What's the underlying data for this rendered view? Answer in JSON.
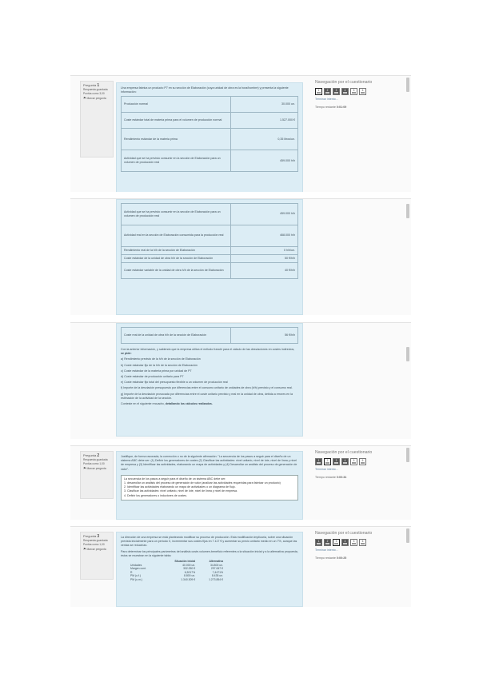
{
  "shot1": {
    "question": {
      "label": "Pregunta",
      "number": "1",
      "status": "Respuesta guardada",
      "score": "Puntúa como 3,00",
      "flag": "Marcar pregunta"
    },
    "intro": "Una empresa fabrica un producto P7 en su sección de Elaboración (cuya unidad de obra es la hora/hombre) y presenta la siguiente información:",
    "table": [
      {
        "label": "Producción normal",
        "value": "30.000 un."
      },
      {
        "label": "Coste estándar total de materia prima para el volumen de producción normal",
        "value": "1.527.000 €"
      },
      {
        "label": "Rendimiento estándar de la materia prima",
        "value": "0,35 litros/un."
      },
      {
        "label": "Actividad que se ha previsto consumir en la sección de Elaboración para un volumen de producción real",
        "value": "459.000 h/h"
      }
    ],
    "nav": {
      "title": "Navegación por el cuestionario",
      "boxes": [
        "1",
        "2",
        "3",
        "4",
        "5",
        "6"
      ],
      "finish": "Terminar intento...",
      "time_label": "Tiempo restante",
      "time_value": "0:01:09"
    }
  },
  "shot2": {
    "table": [
      {
        "label": "Actividad que se ha previsto consumir en la sección de Elaboración para un volumen de producción real",
        "value": "459.000 h/h"
      },
      {
        "label": "Actividad real en la sección de Elaboración consumida para la producción real",
        "value": "468.000 h/h"
      },
      {
        "label": "Rendimiento real de la h/h de la sección de Elaboración",
        "value": "0 h/h/un."
      },
      {
        "label": "Coste estándar de la unidad de obra h/h de la sección de Elaboración",
        "value": "50 €/h/h"
      },
      {
        "label": "Coste estándar variable de la unidad de obra h/h de la sección de Elaboración",
        "value": "40 €/h/h"
      }
    ]
  },
  "shot3": {
    "table": [
      {
        "label": "Coste real de la unidad de obra h/h de la sección de Elaboración",
        "value": "56 €/h/h"
      }
    ],
    "paragraph": "Con la anterior información, y sabiendo que la empresa utiliza el método franchi para el cálculo de las desviaciones en costes indirectos,",
    "ask": "se pide:",
    "items": [
      "a) Rendimiento previsto de la h/h de la sección de Elaboración",
      "b) Coste estándar fijo de la h/h de la sección de Elaboración",
      "c) Coste estándar de la materia prima por unidad de P7",
      "d) Coste estándar de producción unitario para P7",
      "e) Coste estándar fijo total del presupuesto flexible a un volumen de producción real",
      "f) Importe de la desviación presupuesto por diferencias entre el consumo unitario de unidades de obra (h/h) previsto y el consumo real.",
      "g) Importe de la desviación provocada por diferencias entre el coste unitario previsto y real en la unidad de obra, debida a errores en la estimación de la actividad de la sección."
    ],
    "closing": "Conteste en el siguiente recuadro,",
    "closing_bold": "detallando los cálculos realizados."
  },
  "shot4": {
    "question": {
      "label": "Pregunta",
      "number": "2",
      "status": "Respuesta guardada",
      "score": "Puntúa como 1,00",
      "flag": "Marcar pregunta"
    },
    "text": "Justifique, de forma razonada, la corrección o no de la siguiente afirmación: \"La secuencia de los pasos a seguir para el diseño de un sistema ABC debe ser: (1) Definir los generadores de costes (2) Clasificar las actividades: nivel unitario, nivel de lote, nivel de línea y nivel de empresa y (3) Identificar las actividades, elaborando un mapa de actividades y (4) Desarrollar un análisis del proceso de generación de valor\".",
    "answer": [
      "La secuencia de los pasos a seguir para el diseño de un sistema ABC debe ser:",
      "1. desarrollar un análisis del proceso de generación de valor (analizar las actividades requeridas para fabricar un producto)",
      "2. Identificar las actividades elaborando un mapa de actividades o un diagrama de flujo.",
      "3. Clasificar las actividades: nivel unitario, nivel de lote, nivel de línea y nivel de empresa.",
      "4. Definir los generadores o inductores de costes."
    ],
    "nav": {
      "title": "Navegación por el cuestionario",
      "boxes": [
        "1",
        "2",
        "3",
        "4",
        "5",
        "6"
      ],
      "finish": "Terminar intento...",
      "time_label": "Tiempo restante",
      "time_value": "0:00:34"
    }
  },
  "shot5": {
    "question": {
      "label": "Pregunta",
      "number": "3",
      "status": "Respuesta guardada",
      "score": "Puntúa como 1,00",
      "flag": "Marcar pregunta"
    },
    "text1": "La dirección de una empresa se está planteando modificar su proceso de producción. Esta modificación implicaría, sobre una situación prevista inicialmente para un período X, incrementar sus costes fijos en 7.117 € y aumentar su precio unitario medio en un 7%, aunque las ventas se reducirían.",
    "text2": "Para determinar los principales parámetros del análisis coste-volumen-beneficio referentes a la situación inicial y a la alternativa propuesta, éstos se muestran en la siguiente tabla:",
    "headers": [
      "",
      "Situación inicial",
      "Alternativa"
    ],
    "rows": [
      [
        "Unidades",
        "40.000 un.",
        "34.800 un."
      ],
      [
        "Margen cont.",
        "332.250 €",
        "297.067 €"
      ],
      [
        "R",
        "6,5217%",
        "7,4471%"
      ],
      [
        "PM (u.f.)",
        "8.800 un.",
        "8.435 un."
      ],
      [
        "PM (u.m.)",
        "1.340.309 €",
        "1.273.854 €"
      ]
    ],
    "nav": {
      "title": "Navegación por el cuestionario",
      "boxes": [
        "1",
        "2",
        "3",
        "4",
        "5",
        "6"
      ],
      "finish": "Terminar intento...",
      "time_label": "Tiempo restante",
      "time_value": "0:00:25"
    }
  }
}
